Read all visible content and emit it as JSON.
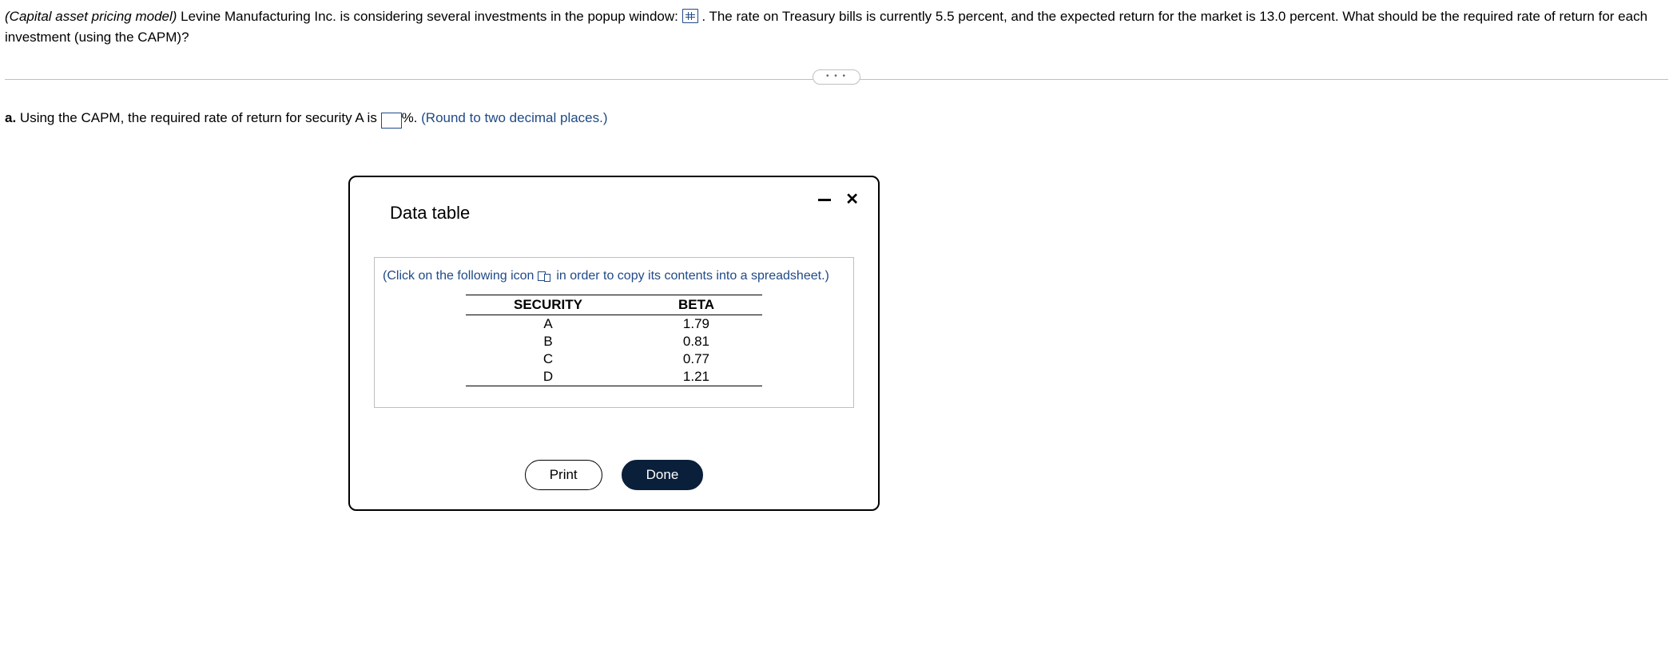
{
  "stem": {
    "italic_intro": "(Capital asset pricing model)",
    "text_before_icon": " Levine Manufacturing Inc. is considering several investments in the popup window: ",
    "text_after_icon": " . The rate on Treasury bills is currently 5.5 percent, and the expected return for the market is 13.0 percent. What should be the required rate of return for each investment (using the CAPM)?"
  },
  "more_label": "• • •",
  "part_a": {
    "label": "a.",
    "before_box": " Using the CAPM, the required rate of return for security A is ",
    "after_box": "%. ",
    "hint": " (Round to two decimal places.)"
  },
  "modal": {
    "title": "Data table",
    "copy_note_before": "(Click on the following icon ",
    "copy_note_after": " in order to copy its contents into a spreadsheet.)",
    "columns": {
      "c1": "SECURITY",
      "c2": "BETA"
    },
    "rows": [
      {
        "security": "A",
        "beta": "1.79"
      },
      {
        "security": "B",
        "beta": "0.81"
      },
      {
        "security": "C",
        "beta": "0.77"
      },
      {
        "security": "D",
        "beta": "1.21"
      }
    ],
    "buttons": {
      "print": "Print",
      "done": "Done"
    },
    "close_glyph": "✕"
  }
}
